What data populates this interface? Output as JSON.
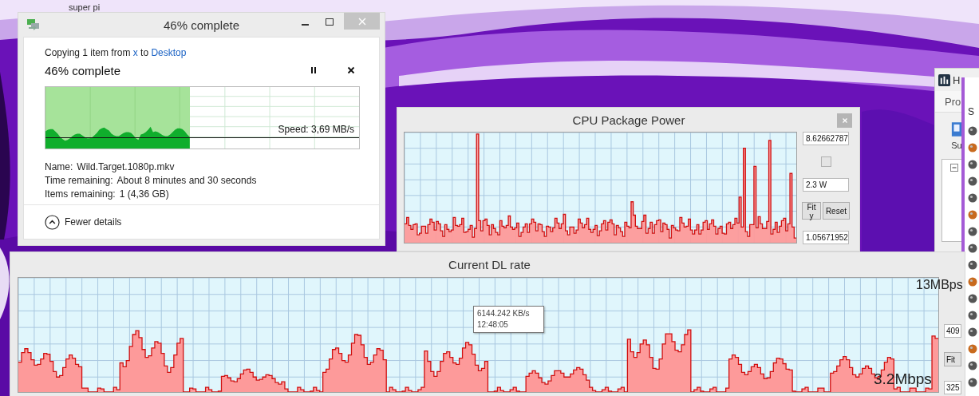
{
  "desktop": {
    "icon_label": "super pi"
  },
  "copy_dialog": {
    "title": "46% complete",
    "status": {
      "prefix": "Copying 1 item from ",
      "source": "x",
      "middle": " to ",
      "destination": "Desktop"
    },
    "heading": "46% complete",
    "level": 0.46,
    "speed": "Speed: 3,69 MB/s",
    "details": [
      {
        "label": "Name:",
        "value": "Wild.Target.1080p.mkv"
      },
      {
        "label": "Time remaining:",
        "value": "About 8 minutes and 30 seconds"
      },
      {
        "label": "Items remaining:",
        "value": "1 (4,36 GB)"
      }
    ],
    "toggle": "Fewer details"
  },
  "cpu_window": {
    "title": "CPU Package Power",
    "max_field": "8.62662787",
    "checked": false,
    "current_field": "2.3 W",
    "buttons": [
      "Fit y",
      "Reset"
    ],
    "min_field": "1.05671952"
  },
  "hwinfo": {
    "title": "H",
    "menu": "Pro",
    "toolbar_label": "Su"
  },
  "sensor_window": {
    "header": "S"
  },
  "dl_window": {
    "title": "Current DL rate",
    "tooltip": {
      "value": "6144.242 KB/s",
      "time": "12:48:05"
    },
    "max_label": "13MBps",
    "min_label": "3.2Mbps",
    "fields": [
      "409",
      "325"
    ],
    "button": "Fit"
  }
}
